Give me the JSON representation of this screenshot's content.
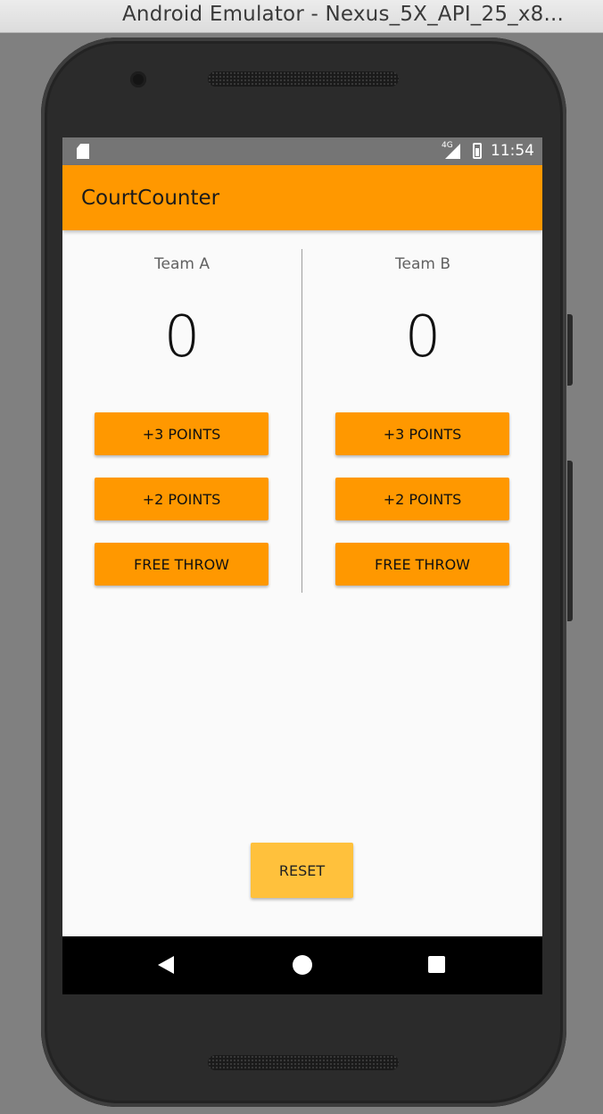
{
  "window": {
    "title": "Android Emulator - Nexus_5X_API_25_x8..."
  },
  "status_bar": {
    "network": "4G",
    "time": "11:54",
    "icons": [
      "sd-card-icon",
      "signal-icon",
      "battery-icon"
    ]
  },
  "app": {
    "title": "CourtCounter"
  },
  "team_a": {
    "name": "Team A",
    "score": "0",
    "buttons": {
      "three": "+3 POINTS",
      "two": "+2 POINTS",
      "free_throw": "FREE THROW"
    }
  },
  "team_b": {
    "name": "Team B",
    "score": "0",
    "buttons": {
      "three": "+3 POINTS",
      "two": "+2 POINTS",
      "free_throw": "FREE THROW"
    }
  },
  "reset": {
    "label": "RESET"
  },
  "nav": {
    "icons": [
      "back-icon",
      "home-icon",
      "recents-icon"
    ]
  },
  "colors": {
    "accent": "#ff9800",
    "reset_button": "#ffc13c",
    "status_bar": "#757575",
    "screen_background": "#fafafa"
  }
}
